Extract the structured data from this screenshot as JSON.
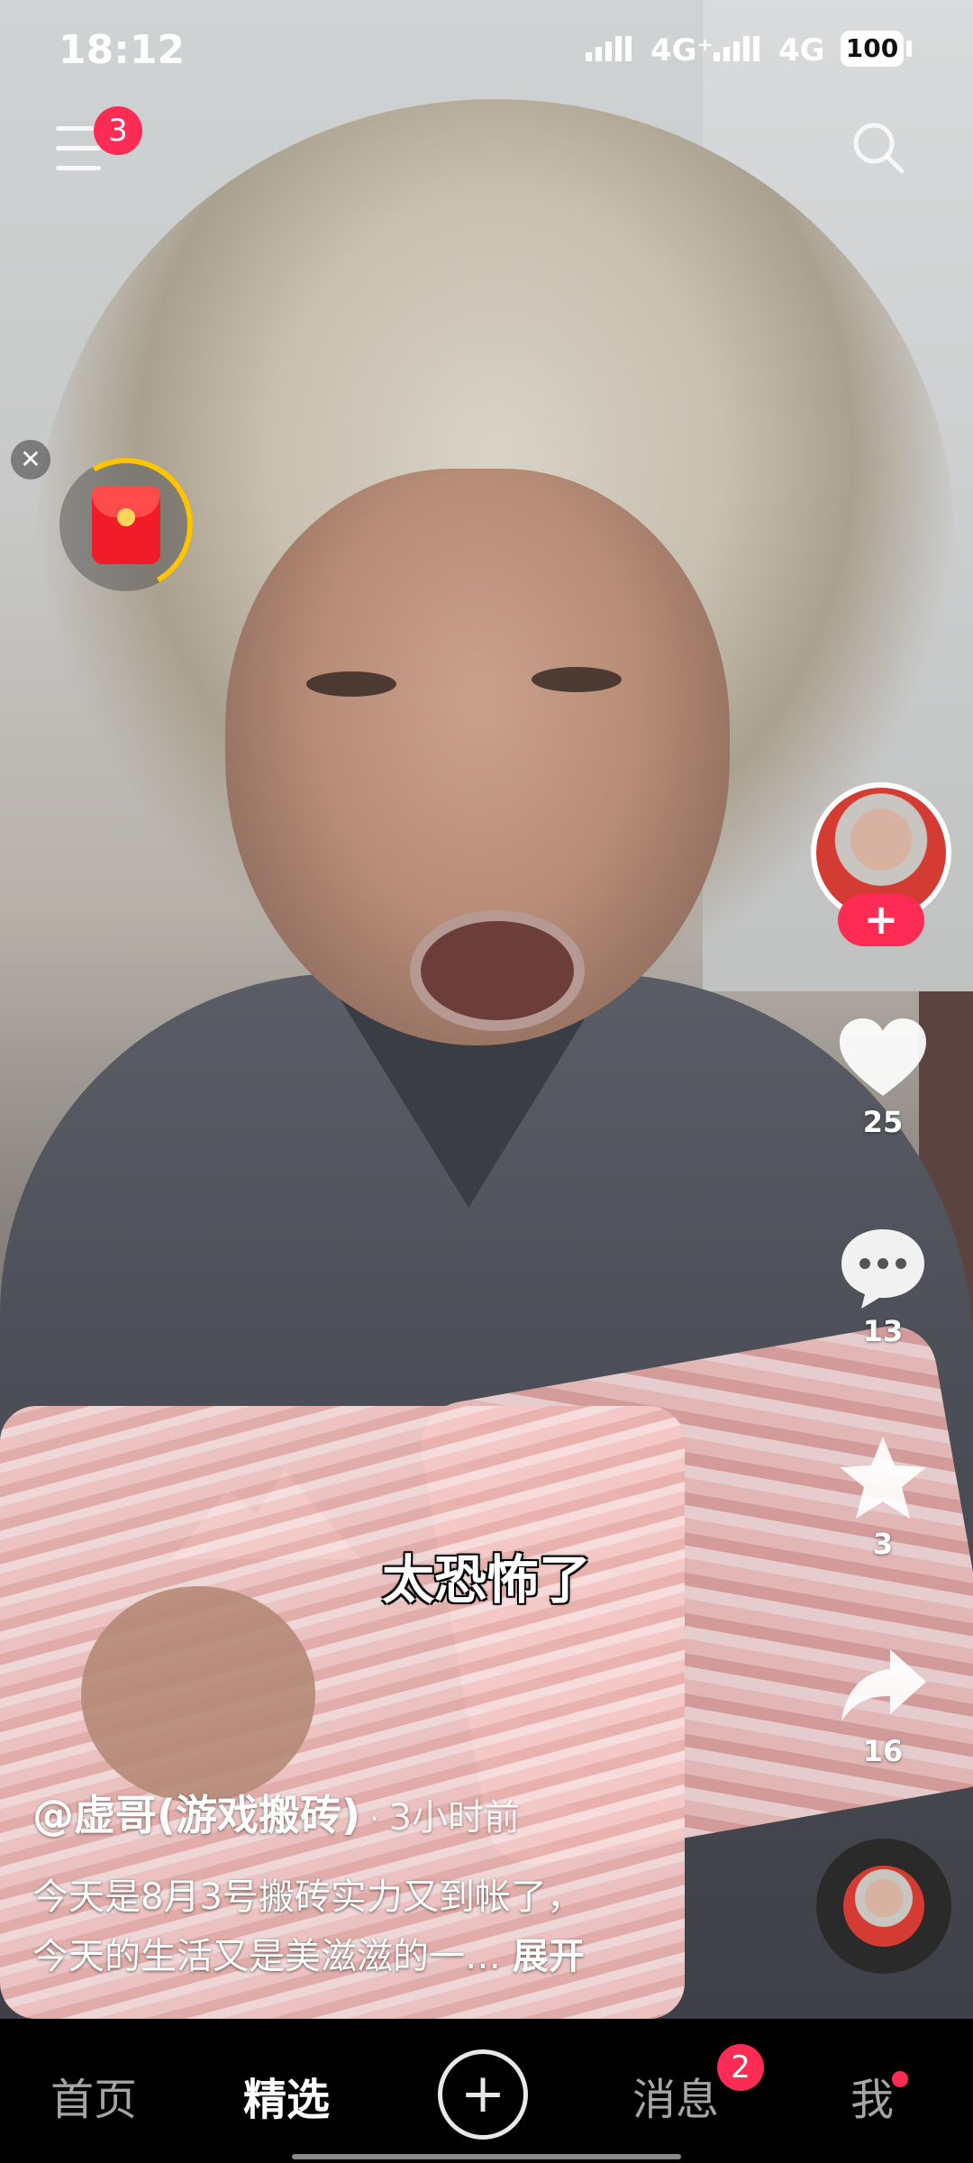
{
  "status_bar": {
    "time": "18:12",
    "network_1": "4G⁺",
    "network_2": "4G",
    "battery": "100"
  },
  "top": {
    "menu_badge": "3"
  },
  "red_packet": {
    "close": "✕"
  },
  "video": {
    "subtitle": "太恐怖了",
    "author": "@虚哥(游戏搬砖)",
    "separator": "·",
    "posted": "3小时前",
    "description_line1": "今天是8月3号搬砖实力又到帐了，",
    "description_line2": "今天的生活又是美滋滋的一…",
    "expand": "展开"
  },
  "actions": {
    "follow": "+",
    "likes": "25",
    "comments": "13",
    "favorites": "3",
    "shares": "16"
  },
  "bottom_nav": {
    "home": "首页",
    "featured": "精选",
    "create": "+",
    "messages": "消息",
    "messages_badge": "2",
    "me": "我"
  },
  "colors": {
    "accent": "#fe2c55",
    "progress_ring": "#ffc400"
  }
}
